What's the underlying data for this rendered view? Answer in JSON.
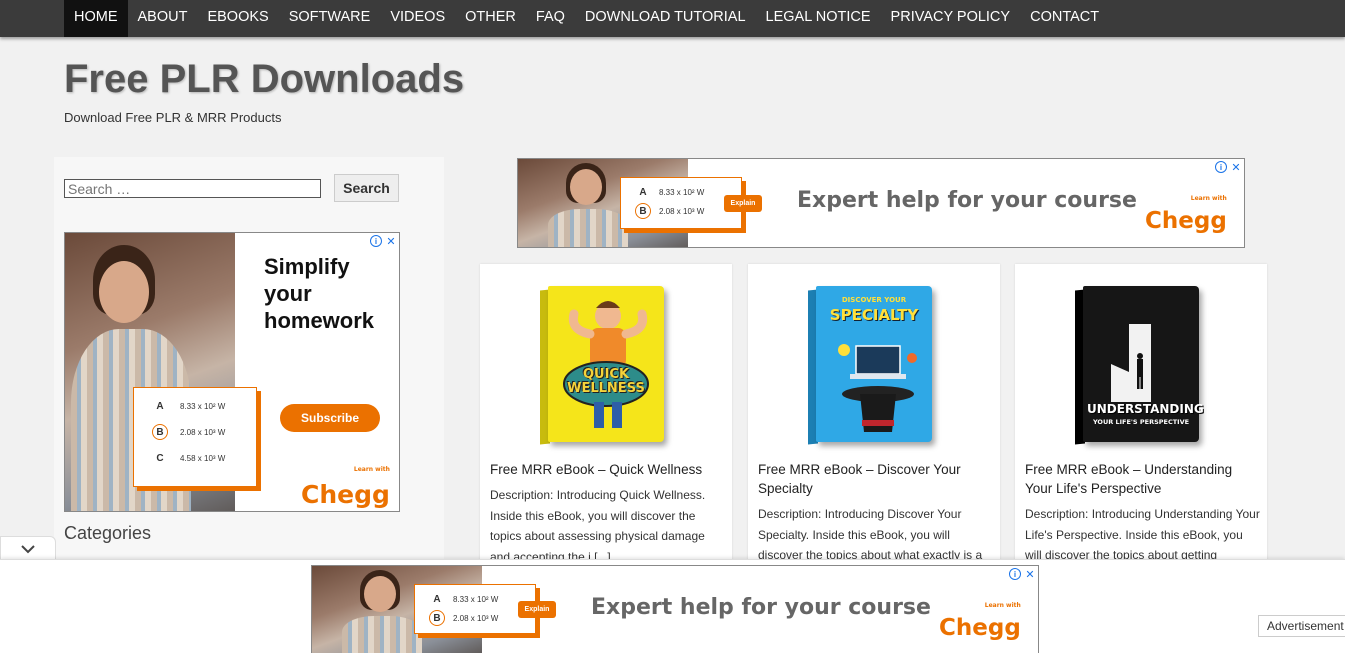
{
  "nav": {
    "items": [
      "HOME",
      "ABOUT",
      "EBOOKS",
      "SOFTWARE",
      "VIDEOS",
      "OTHER",
      "FAQ",
      "DOWNLOAD TUTORIAL",
      "LEGAL NOTICE",
      "PRIVACY POLICY",
      "CONTACT"
    ],
    "active": "HOME"
  },
  "site": {
    "title": "Free PLR Downloads",
    "description": "Download Free PLR & MRR Products"
  },
  "sidebar": {
    "search_placeholder": "Search …",
    "search_button": "Search",
    "categories_heading": "Categories",
    "ad": {
      "headline_line1": "Simplify",
      "headline_line2": "your",
      "headline_line3": "homework",
      "choices": [
        {
          "letter": "A",
          "value": "8.33 x 10² W"
        },
        {
          "letter": "B",
          "value": "2.08 x 10³ W"
        },
        {
          "letter": "C",
          "value": "4.58 x 10³ W"
        }
      ],
      "cta": "Subscribe",
      "brand": "Chegg",
      "brand_tag": "Learn with"
    }
  },
  "top_ad": {
    "choices": [
      {
        "letter": "A",
        "value": "8.33 x 10² W"
      },
      {
        "letter": "B",
        "value": "2.08 x 10³ W"
      }
    ],
    "cta": "Explain",
    "headline": "Expert help for your course",
    "brand": "Chegg",
    "brand_tag": "Learn with"
  },
  "posts": [
    {
      "title": "Free MRR eBook – Quick Wellness",
      "description": "Description: Introducing Quick Wellness. Inside this eBook, you will discover the topics about assessing physical damage and accepting the i [...]",
      "cover_text": "QUICK WELLNESS",
      "cover_color": "#f5e51a"
    },
    {
      "title": "Free MRR eBook – Discover Your Specialty",
      "description": "Description: Introducing Discover Your Specialty. Inside this eBook, you will discover the topics about what exactly is a",
      "cover_text_small": "DISCOVER YOUR",
      "cover_text": "SPECIALTY",
      "cover_color": "#2fa8e6"
    },
    {
      "title": "Free MRR eBook – Understanding Your Life's Perspective",
      "description": "Description: Introducing Understanding Your Life's Perspective. Inside this eBook, you will discover the topics about getting",
      "cover_text": "UNDERSTANDING",
      "cover_text_small": "YOUR LIFE'S PERSPECTIVE",
      "cover_color": "#111111"
    }
  ],
  "bottom_ad": {
    "choices": [
      {
        "letter": "A",
        "value": "8.33 x 10² W"
      },
      {
        "letter": "B",
        "value": "2.08 x 10³ W"
      }
    ],
    "cta": "Explain",
    "headline": "Expert help for your course",
    "brand": "Chegg",
    "brand_tag": "Learn with"
  },
  "advertisement_label": "Advertisement",
  "colors": {
    "accent": "#eb7100",
    "nav_bg": "#3b3b3b",
    "nav_active": "#111111"
  }
}
